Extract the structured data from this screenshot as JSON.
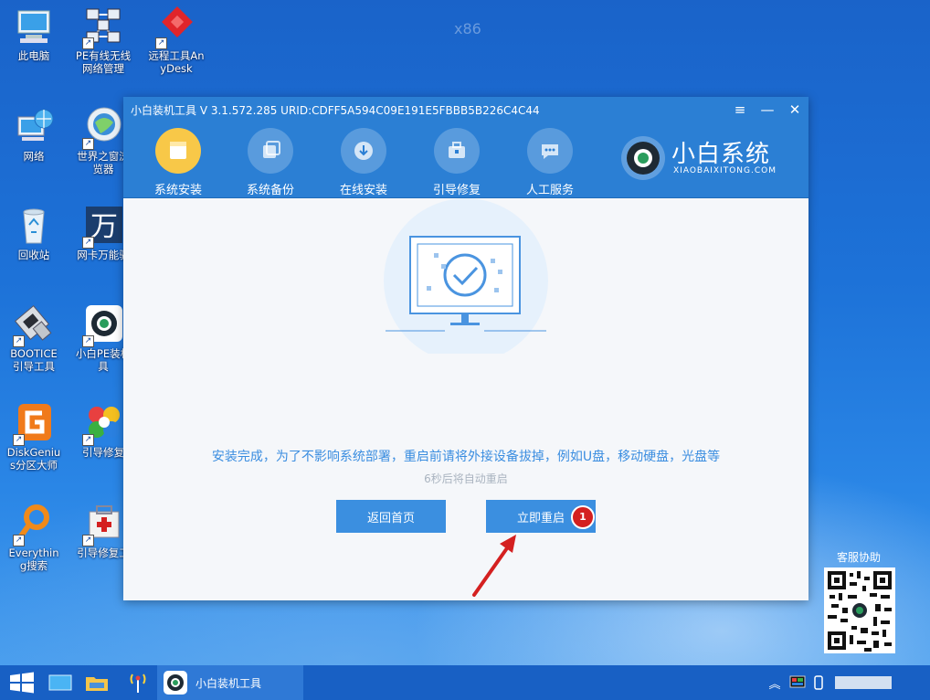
{
  "desktop": {
    "watermark": "x86",
    "icons": [
      {
        "label": "此电脑",
        "icon": "computer-icon"
      },
      {
        "label": "PE有线无线网络管理",
        "icon": "network-manager-icon"
      },
      {
        "label": "远程工具AnyDesk",
        "icon": "anydesk-icon"
      },
      {
        "label": "网络",
        "icon": "network-globe-icon"
      },
      {
        "label": "世界之窗浏览器",
        "icon": "browser-icon"
      },
      {
        "label": "回收站",
        "icon": "recycle-bin-icon"
      },
      {
        "label": "网卡万能驱",
        "icon": "netcard-driver-icon"
      },
      {
        "label": "BOOTICE引导工具",
        "icon": "bootice-icon"
      },
      {
        "label": "小白PE装机具",
        "icon": "xiaobai-pe-icon"
      },
      {
        "label": "DiskGenius分区大师",
        "icon": "diskgenius-icon"
      },
      {
        "label": "引导修复",
        "icon": "boot-repair-icon"
      },
      {
        "label": "Everything搜索",
        "icon": "everything-search-icon"
      },
      {
        "label": "引导修复工",
        "icon": "boot-repair-tool-icon"
      }
    ],
    "shortcut_glyph": "↗"
  },
  "window": {
    "title": "小白装机工具 V 3.1.572.285 URID:CDFF5A594C09E191E5FBBB5B226C4C44",
    "controls": {
      "menu": "≡",
      "minimize": "—",
      "close": "✕"
    },
    "nav": [
      {
        "label": "系统安装",
        "icon": "system-install-icon",
        "active": true
      },
      {
        "label": "系统备份",
        "icon": "system-backup-icon",
        "active": false
      },
      {
        "label": "在线安装",
        "icon": "online-install-icon",
        "active": false
      },
      {
        "label": "引导修复",
        "icon": "boot-repair-icon",
        "active": false
      },
      {
        "label": "人工服务",
        "icon": "chat-service-icon",
        "active": false
      }
    ],
    "brand": {
      "name": "小白系统",
      "sub": "XIAOBAIXITONG.COM"
    },
    "message": "安装完成，为了不影响系统部署，重启前请将外接设备拔掉，例如U盘，移动硬盘，光盘等",
    "countdown": "6秒后将自动重启",
    "buttons": {
      "home": "返回首页",
      "restart": "立即重启"
    },
    "badge": "1"
  },
  "support": {
    "label": "客服协助"
  },
  "taskbar": {
    "app_name": "小白装机工具",
    "tray_up": "︽"
  },
  "colors": {
    "accent": "#2b7fd4",
    "button": "#3b8fe0",
    "badge": "#d42020",
    "message": "#3a8de0"
  }
}
